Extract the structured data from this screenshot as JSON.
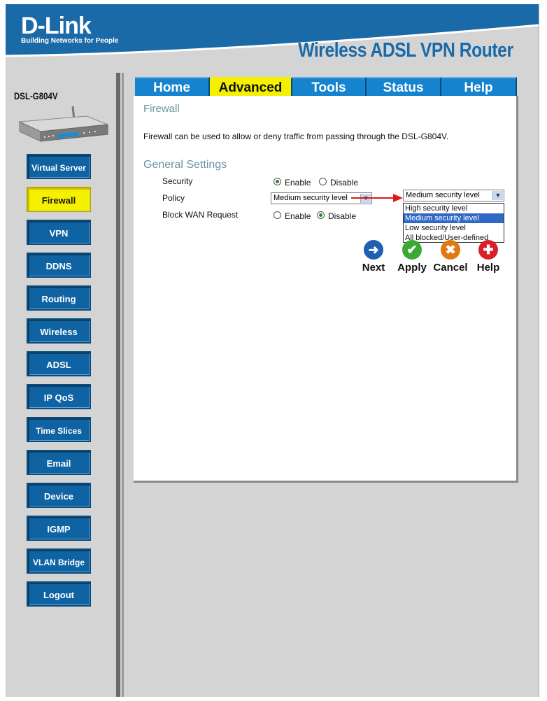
{
  "header": {
    "logo": "D-Link",
    "tagline": "Building Networks for People",
    "product": "Wireless ADSL VPN Router"
  },
  "sidebar": {
    "model": "DSL-G804V",
    "items": [
      {
        "label": "Virtual Server"
      },
      {
        "label": "Firewall"
      },
      {
        "label": "VPN"
      },
      {
        "label": "DDNS"
      },
      {
        "label": "Routing"
      },
      {
        "label": "Wireless"
      },
      {
        "label": "ADSL"
      },
      {
        "label": "IP QoS"
      },
      {
        "label": "Time Slices"
      },
      {
        "label": "Email"
      },
      {
        "label": "Device"
      },
      {
        "label": "IGMP"
      },
      {
        "label": "VLAN Bridge"
      },
      {
        "label": "Logout"
      }
    ]
  },
  "tabs": [
    {
      "label": "Home"
    },
    {
      "label": "Advanced"
    },
    {
      "label": "Tools"
    },
    {
      "label": "Status"
    },
    {
      "label": "Help"
    }
  ],
  "main": {
    "title": "Firewall",
    "description": "Firewall can be used to allow or deny traffic from passing through the DSL-G804V.",
    "section_title": "General Settings",
    "security": {
      "label": "Security",
      "enable": "Enable",
      "disable": "Disable",
      "selected": "Enable"
    },
    "policy": {
      "label": "Policy",
      "value": "Medium security level",
      "options": [
        "High security level",
        "Medium security level",
        "Low security level",
        "All blocked/User-defined"
      ]
    },
    "block_wan": {
      "label": "Block WAN Request",
      "enable": "Enable",
      "disable": "Disable",
      "selected": "Disable"
    }
  },
  "actions": {
    "next": "Next",
    "apply": "Apply",
    "cancel": "Cancel",
    "help": "Help"
  },
  "colors": {
    "brand_blue": "#1a6aa8",
    "active_yellow": "#f4f000",
    "section_text": "#6a93a8"
  }
}
